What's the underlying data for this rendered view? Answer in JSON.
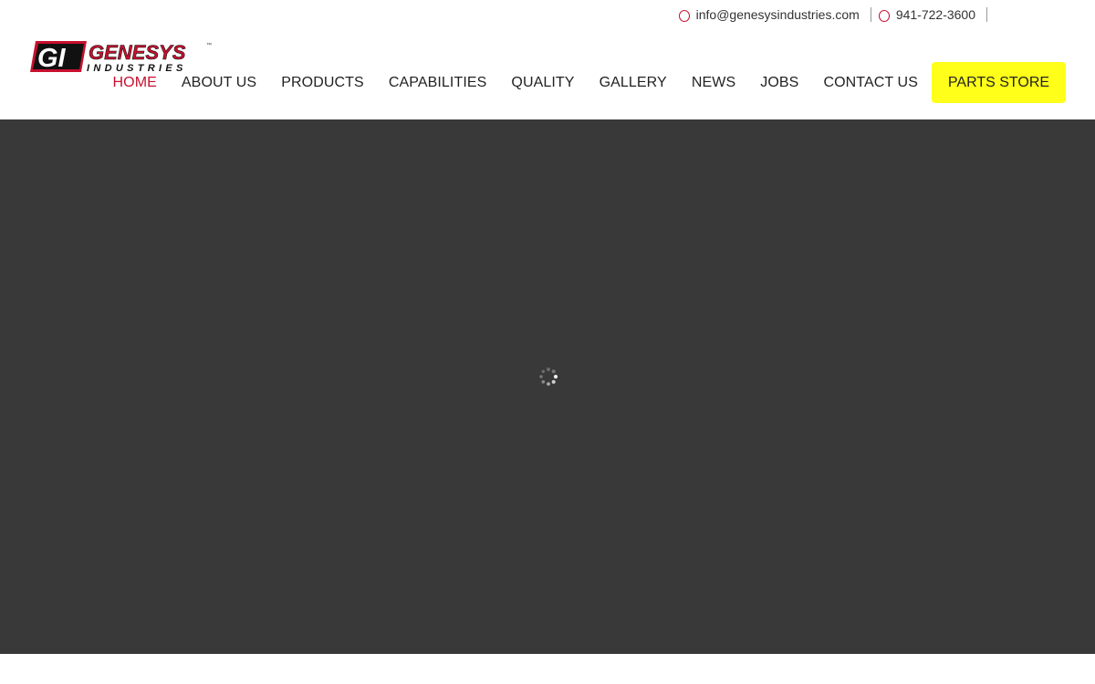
{
  "brand": {
    "logo_initials": "GI",
    "logo_name": "GENESYS",
    "logo_sub": "INDUSTRIES",
    "logo_tm": "™",
    "colors": {
      "accent_red": "#c8102e",
      "parts_store_bg": "#ffff1a",
      "hero_bg": "#393939"
    }
  },
  "top_contact": {
    "email": "info@genesysindustries.com",
    "email_icon": "envelope-icon",
    "phone": "941-722-3600",
    "phone_icon": "phone-icon"
  },
  "nav": {
    "items": [
      {
        "label": "HOME",
        "active": true
      },
      {
        "label": "ABOUT US",
        "active": false
      },
      {
        "label": "PRODUCTS",
        "active": false
      },
      {
        "label": "CAPABILITIES",
        "active": false
      },
      {
        "label": "QUALITY",
        "active": false
      },
      {
        "label": "GALLERY",
        "active": false
      },
      {
        "label": "NEWS",
        "active": false
      },
      {
        "label": "JOBS",
        "active": false
      },
      {
        "label": "CONTACT US",
        "active": false
      }
    ],
    "cta_label": "PARTS STORE"
  },
  "hero": {
    "state": "loading",
    "loader_icon": "spinner-icon"
  }
}
